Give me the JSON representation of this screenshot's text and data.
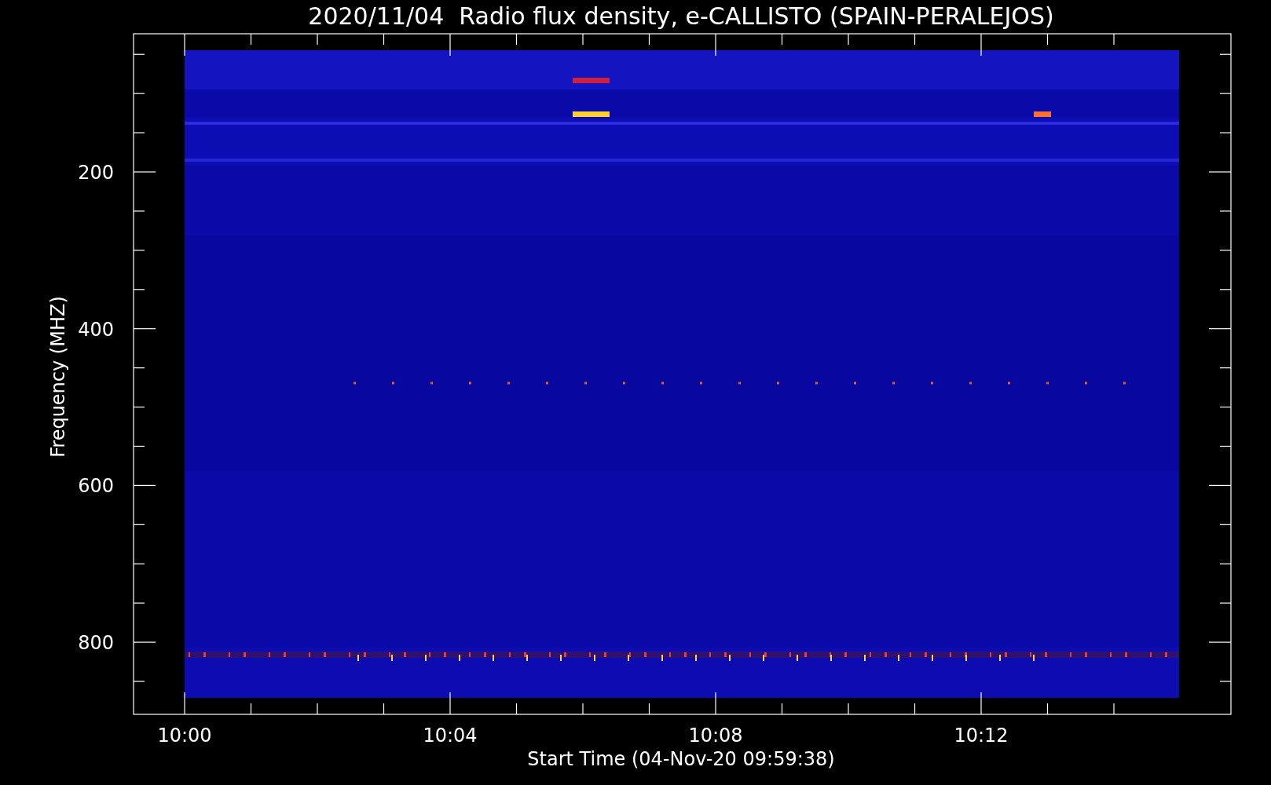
{
  "title": "2020/11/04  Radio flux density, e-CALLISTO (SPAIN-PERALEJOS)",
  "y_axis": {
    "label": "Frequency (MHZ)",
    "ticks": [
      "200",
      "400",
      "600",
      "800"
    ]
  },
  "x_axis": {
    "label": "Start Time (04-Nov-20 09:59:38)",
    "ticks": [
      "10:00",
      "10:04",
      "10:08",
      "10:12"
    ]
  }
}
